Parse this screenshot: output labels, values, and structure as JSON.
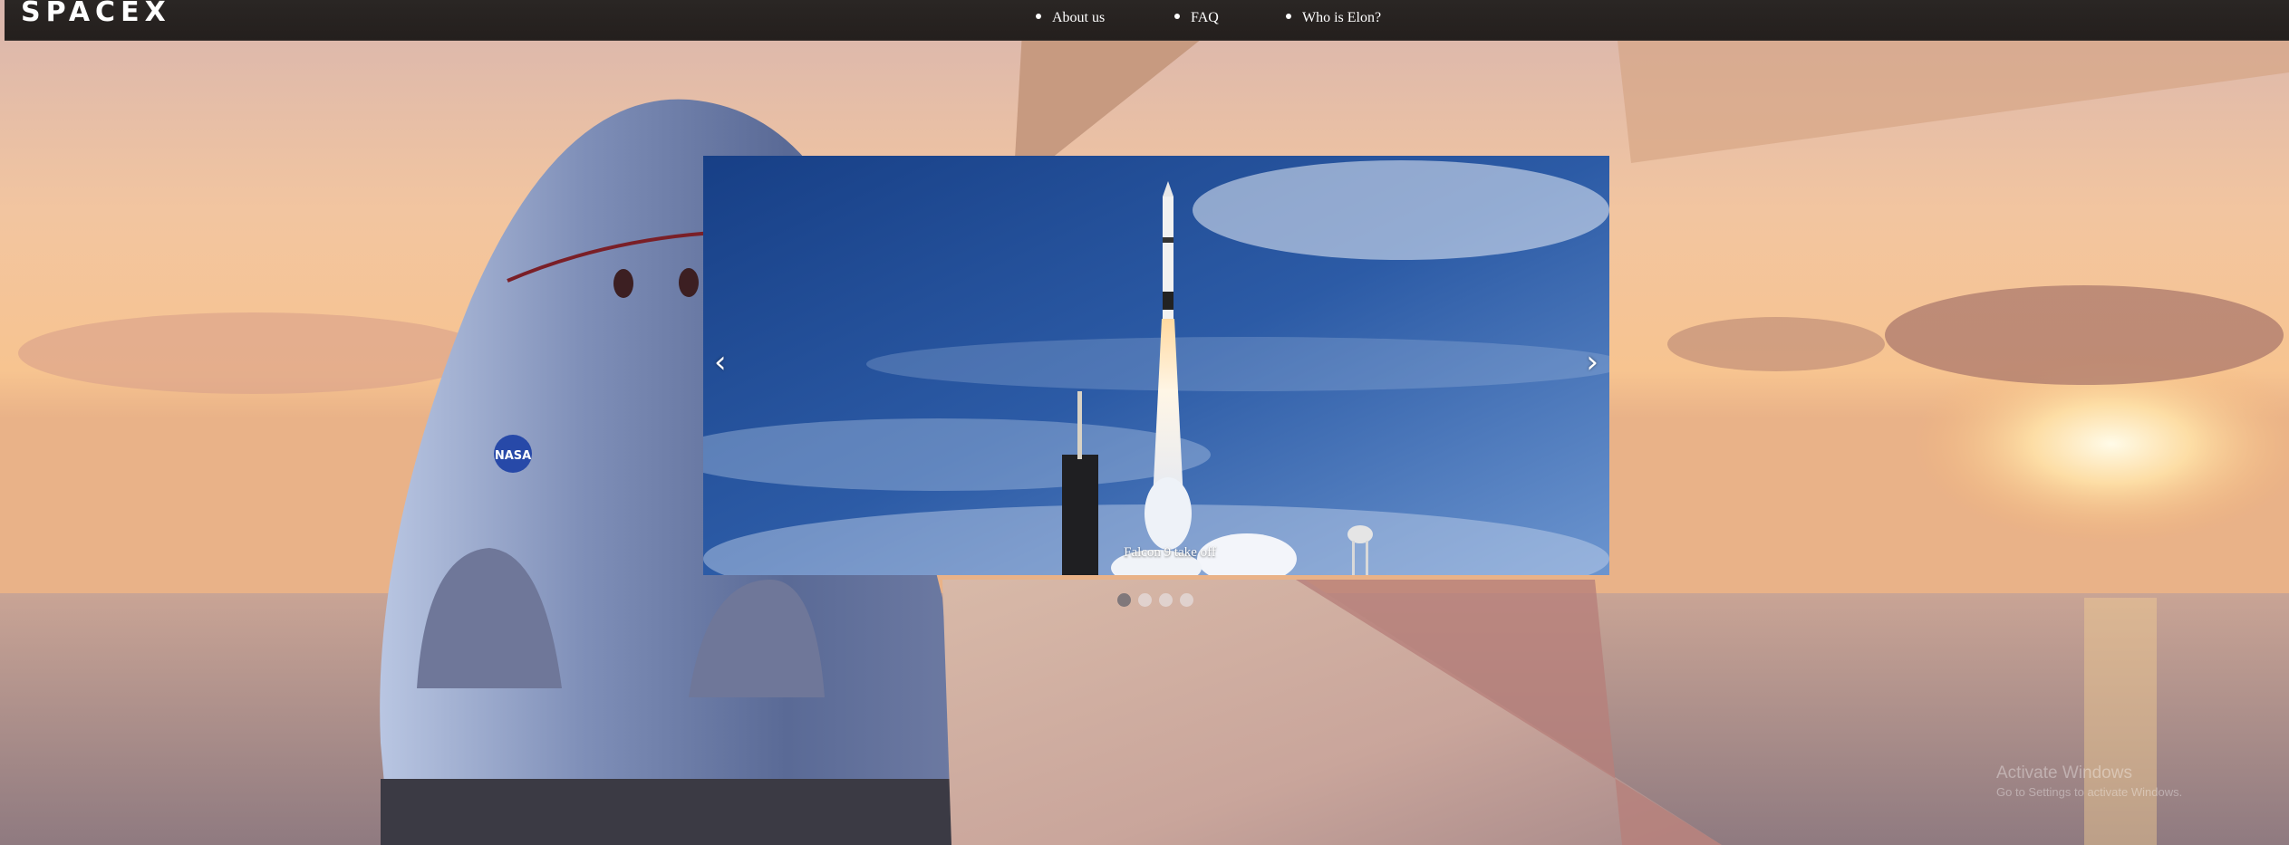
{
  "brand": {
    "logo_text": "SPACEX"
  },
  "nav": {
    "items": [
      {
        "label": "About us"
      },
      {
        "label": "FAQ"
      },
      {
        "label": "Who is Elon?"
      }
    ]
  },
  "carousel": {
    "prev_icon": "‹",
    "next_icon": "›",
    "caption": "Falcon 9 take off",
    "slide_count": 4,
    "active_slide": 1
  },
  "watermark": {
    "title": "Activate Windows",
    "subtitle": "Go to Settings to activate Windows."
  },
  "colors": {
    "navbar": "#241f1d",
    "sky_blue": "#2a5aa8",
    "sunset": "#f0b98a"
  }
}
